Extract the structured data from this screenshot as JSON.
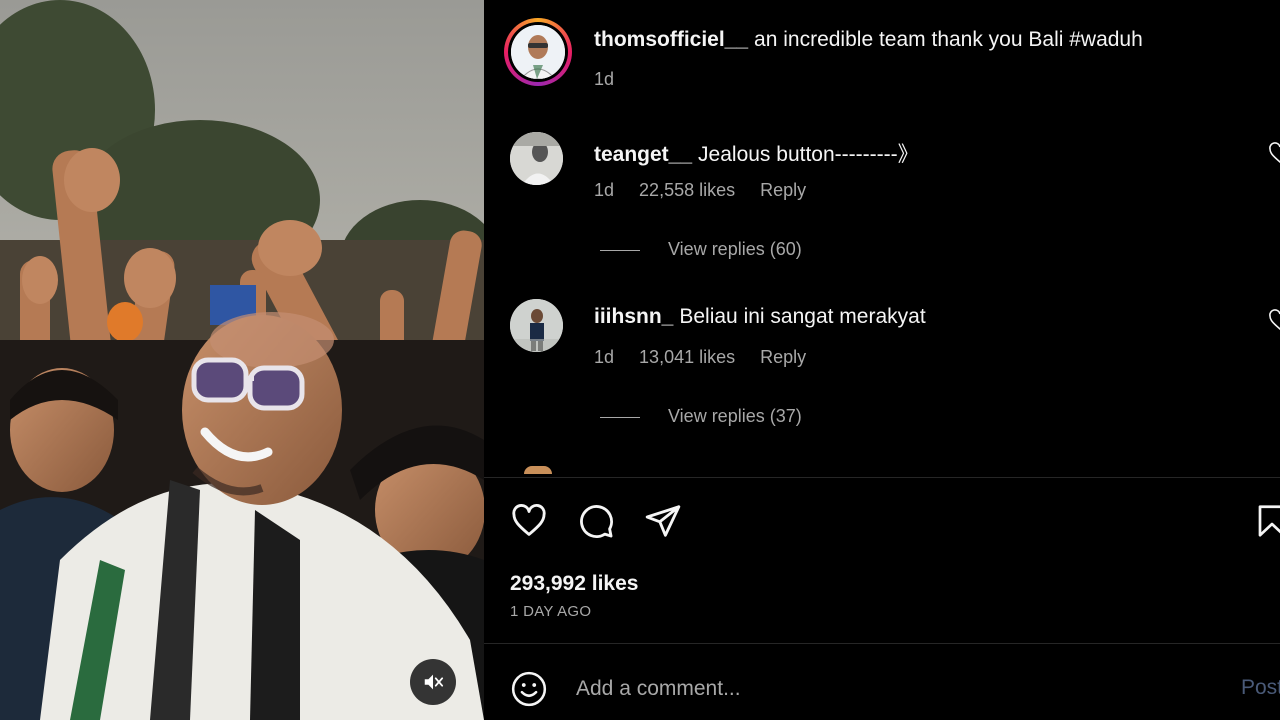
{
  "post": {
    "username": "thomsofficiel__",
    "caption": "an incredible team thank you Bali #waduh",
    "time": "1d",
    "likes": "293,992 likes",
    "date": "1 DAY AGO"
  },
  "comments": [
    {
      "username": "teanget__",
      "text": "Jealous button---------》",
      "time": "1d",
      "likes": "22,558 likes",
      "reply_label": "Reply",
      "view_replies": "View replies (60)"
    },
    {
      "username": "iiihsnn_",
      "text": "Beliau ini sangat merakyat",
      "time": "1d",
      "likes": "13,041 likes",
      "reply_label": "Reply",
      "view_replies": "View replies (37)"
    }
  ],
  "actions": {
    "like_icon": "heart-icon",
    "comment_icon": "comment-icon",
    "share_icon": "share-icon",
    "save_icon": "bookmark-icon"
  },
  "comment_box": {
    "placeholder": "Add a comment...",
    "post_label": "Post",
    "emoji_icon": "emoji-icon"
  },
  "media": {
    "mute_icon": "speaker-muted-icon"
  },
  "colors": {
    "background": "#000000",
    "text_primary": "#f5f5f5",
    "text_secondary": "#a8a8a8",
    "post_button": "#4a5a78"
  }
}
